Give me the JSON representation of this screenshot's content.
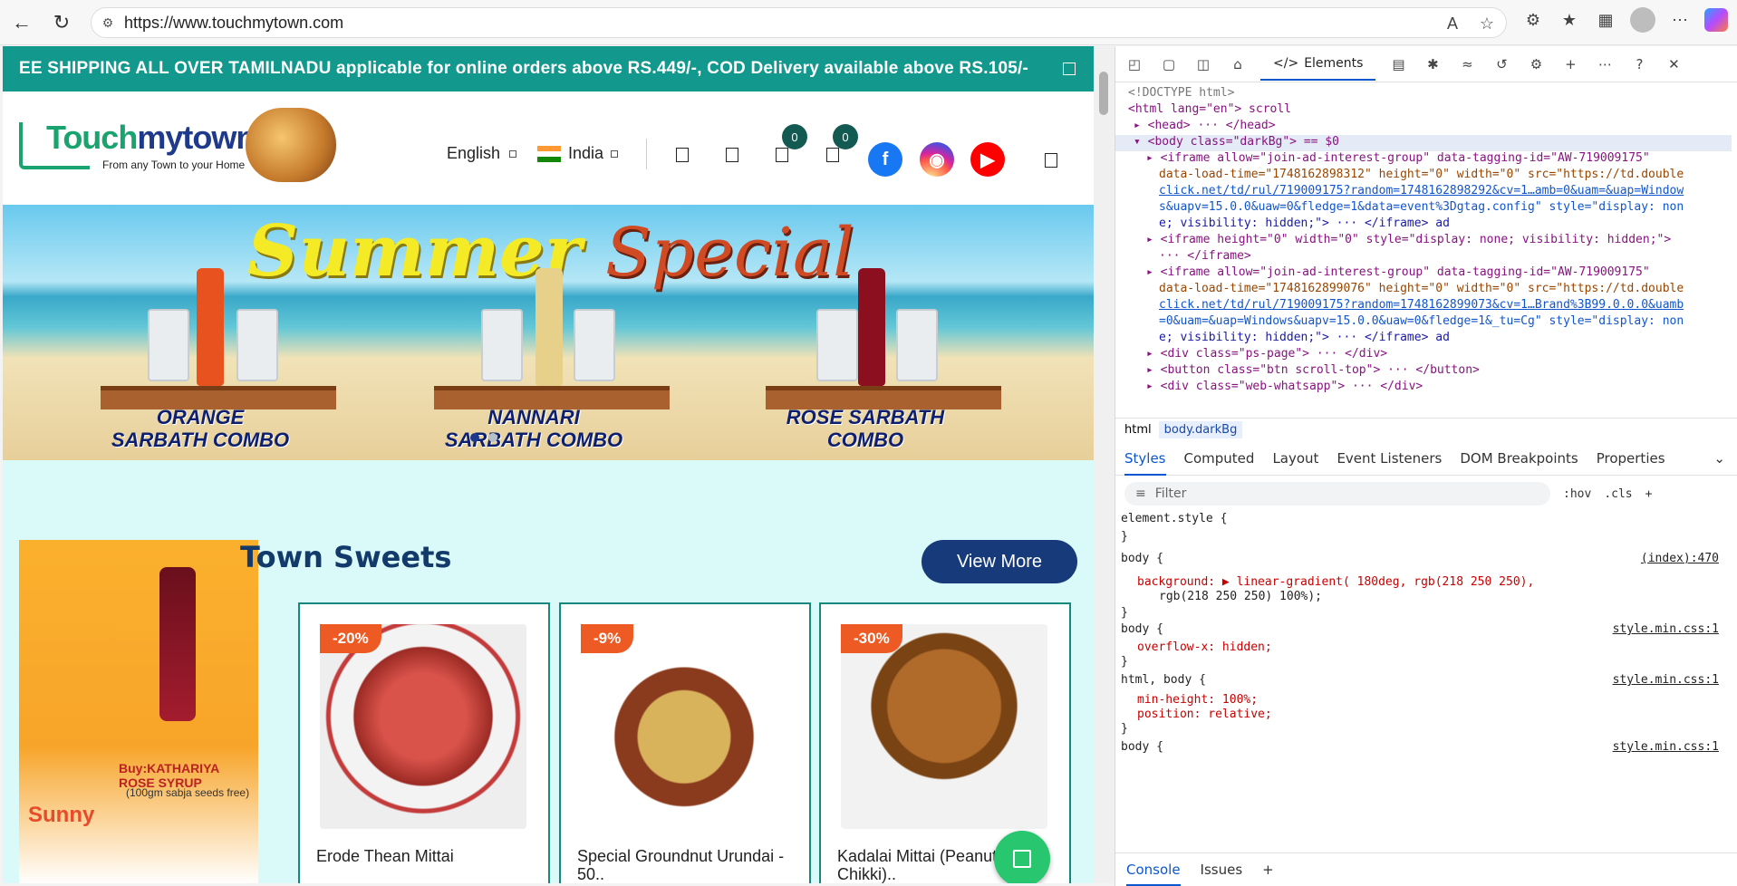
{
  "browser": {
    "url": "https://www.touchmytown.com",
    "back_icon": "arrow-left-icon",
    "refresh_icon": "refresh-icon"
  },
  "site": {
    "announcement": "EE SHIPPING ALL OVER TAMILNADU applicable for online orders above RS.449/-, COD Delivery available above RS.105/-",
    "logo": {
      "brand_part1": "Touch",
      "brand_part2": "mytown",
      "tagline": "From any Town to your Home"
    },
    "language": "English",
    "country": "India",
    "wishlist_count": "0",
    "cart_count": "0",
    "banner": {
      "title_left": "Summer",
      "title_right": "Special",
      "combos": [
        "ORANGE SARBATH COMBO",
        "NANNARI SARBATH COMBO",
        "ROSE SARBATH COMBO"
      ]
    },
    "promo": {
      "buy_text": "Buy:KATHARIYA ROSE SYRUP",
      "free_text": "(100gm sabja seeds free)",
      "brand_text": "Sunny"
    },
    "section": {
      "title": "Town Sweets",
      "view_more": "View More",
      "products": [
        {
          "discount": "-20%",
          "name": "Erode Thean Mittai",
          "color": "#c8473a"
        },
        {
          "discount": "-9%",
          "name": "Special Groundnut Urundai - 50..",
          "color": "#c9a14e"
        },
        {
          "discount": "-30%",
          "name": "Kadalai Mittai (Peanut Chikki)..",
          "color": "#a8662a"
        }
      ]
    }
  },
  "devtools": {
    "elements_tab": "Elements",
    "dom_lines": [
      "<!DOCTYPE html>",
      "<html lang=\"en\"> scroll",
      "▸ <head> ··· </head>",
      "▾ <body class=\"darkBg\"> == $0",
      "▸ <iframe allow=\"join-ad-interest-group\" data-tagging-id=\"AW-719009175\"",
      "data-load-time=\"1748162898312\" height=\"0\" width=\"0\" src=\"https://td.double",
      "click.net/td/rul/719009175?random=1748162898292&cv=1…amb=0&uam=&uap=Window",
      "s&uapv=15.0.0&uaw=0&fledge=1&data=event%3Dgtag.config\" style=\"display: non",
      "e; visibility: hidden;\"> ··· </iframe> ad",
      "▸ <iframe height=\"0\" width=\"0\" style=\"display: none; visibility: hidden;\">",
      "··· </iframe>",
      "▸ <iframe allow=\"join-ad-interest-group\" data-tagging-id=\"AW-719009175\"",
      "data-load-time=\"1748162899076\" height=\"0\" width=\"0\" src=\"https://td.double",
      "click.net/td/rul/719009175?random=1748162899073&cv=1…Brand%3B99.0.0.0&uamb",
      "=0&uam=&uap=Windows&uapv=15.0.0&uaw=0&fledge=1&_tu=Cg\" style=\"display: non",
      "e; visibility: hidden;\"> ··· </iframe> ad",
      "▸ <div class=\"ps-page\"> ··· </div>",
      "▸ <button class=\"btn scroll-top\"> ··· </button>",
      "▸ <div class=\"web-whatsapp\"> ··· </div>"
    ],
    "breadcrumbs": [
      "html",
      "body.darkBg"
    ],
    "sub_tabs": [
      "Styles",
      "Computed",
      "Layout",
      "Event Listeners",
      "DOM Breakpoints",
      "Properties"
    ],
    "filter_placeholder": "Filter",
    "hov": ":hov",
    "cls": ".cls",
    "rules": [
      {
        "text": "element.style {",
        "src": ""
      },
      {
        "text": "}",
        "src": ""
      },
      {
        "text": "body {",
        "src": "(index):470"
      },
      {
        "text": "background: ▶ linear-gradient( 180deg, rgb(218 250 250),",
        "src": ""
      },
      {
        "text": "rgb(218 250 250) 100%);",
        "src": ""
      },
      {
        "text": "}",
        "src": ""
      },
      {
        "text": "body {",
        "src": "style.min.css:1"
      },
      {
        "text": "overflow-x: hidden;",
        "src": ""
      },
      {
        "text": "}",
        "src": ""
      },
      {
        "text": "html, body {",
        "src": "style.min.css:1"
      },
      {
        "text": "min-height: 100%;",
        "src": ""
      },
      {
        "text": "position: relative;",
        "src": ""
      },
      {
        "text": "}",
        "src": ""
      },
      {
        "text": "body {",
        "src": "style.min.css:1"
      }
    ],
    "drawer_tabs": [
      "Console",
      "Issues"
    ]
  }
}
